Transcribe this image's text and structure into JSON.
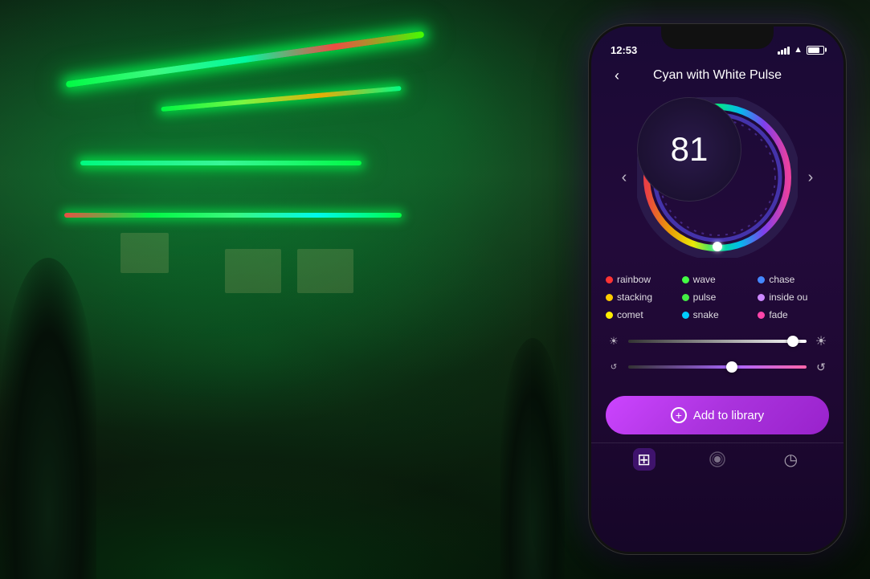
{
  "background": {
    "description": "House with LED Christmas lights at night"
  },
  "phone": {
    "status_bar": {
      "time": "12:53",
      "signal": "full",
      "wifi": true,
      "battery": 75
    },
    "header": {
      "title": "Cyan with White Pulse",
      "back_label": "<"
    },
    "dial": {
      "value": "81",
      "left_arrow": "<",
      "right_arrow": ">"
    },
    "effects": [
      {
        "label": "rainbow",
        "color": "#ff3333"
      },
      {
        "label": "wave",
        "color": "#44ff44"
      },
      {
        "label": "chase",
        "color": "#4488ff"
      },
      {
        "label": "stacking",
        "color": "#ffcc00"
      },
      {
        "label": "pulse",
        "color": "#44ee44"
      },
      {
        "label": "inside ou",
        "color": "#cc88ff"
      },
      {
        "label": "comet",
        "color": "#ffee00"
      },
      {
        "label": "snake",
        "color": "#00ccff"
      },
      {
        "label": "fade",
        "color": "#ff44aa"
      }
    ],
    "sliders": {
      "brightness": {
        "value": 90,
        "min_icon": "☀",
        "max_icon": "☀"
      },
      "speed": {
        "value": 55,
        "min_icon": "↺",
        "max_icon": "↺"
      }
    },
    "add_button": {
      "label": "Add to library",
      "icon": "+"
    },
    "bottom_nav": [
      {
        "icon": "⊞",
        "label": "add",
        "active": true
      },
      {
        "icon": "⚉",
        "label": "effects",
        "active": false
      },
      {
        "icon": "◷",
        "label": "schedule",
        "active": false
      }
    ]
  }
}
